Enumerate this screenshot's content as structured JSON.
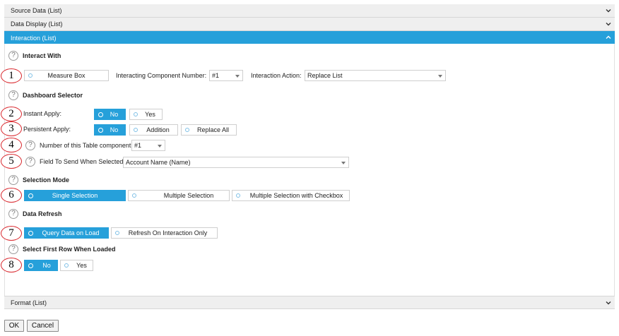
{
  "accordion": {
    "source_data": "Source Data (List)",
    "data_display": "Data Display (List)",
    "interaction": "Interaction (List)",
    "format": "Format (List)"
  },
  "colors": {
    "accent": "#26a0da",
    "annotation": "#d9262c"
  },
  "interact_with": {
    "title": "Interact With",
    "measure_box": "Measure Box",
    "component_number_label": "Interacting Component Number:",
    "component_number_value": "#1",
    "action_label": "Interaction Action:",
    "action_value": "Replace List"
  },
  "dashboard_selector": {
    "title": "Dashboard Selector",
    "instant_apply_label": "Instant Apply:",
    "instant_apply_options": [
      "No",
      "Yes"
    ],
    "instant_apply_selected": "No",
    "persistent_apply_label": "Persistent Apply:",
    "persistent_apply_options": [
      "No",
      "Addition",
      "Replace All"
    ],
    "persistent_apply_selected": "No",
    "table_component_label": "Number of this Table component",
    "table_component_value": "#1",
    "field_to_send_label": "Field To Send When Selected",
    "field_to_send_value": "Account Name (Name)"
  },
  "selection_mode": {
    "title": "Selection Mode",
    "options": [
      "Single Selection",
      "Multiple Selection",
      "Multiple Selection with Checkbox"
    ],
    "selected": "Single Selection"
  },
  "data_refresh": {
    "title": "Data Refresh",
    "options": [
      "Query Data on Load",
      "Refresh On Interaction Only"
    ],
    "selected": "Query Data on Load"
  },
  "select_first_row": {
    "title": "Select First Row When Loaded",
    "options": [
      "No",
      "Yes"
    ],
    "selected": "No"
  },
  "annotations": [
    "1",
    "2",
    "3",
    "4",
    "5",
    "6",
    "7",
    "8"
  ],
  "icons": {
    "help": "?",
    "collapse": "chevron-down-icon",
    "expand": "chevron-up-icon"
  },
  "footer": {
    "ok": "OK",
    "cancel": "Cancel"
  }
}
